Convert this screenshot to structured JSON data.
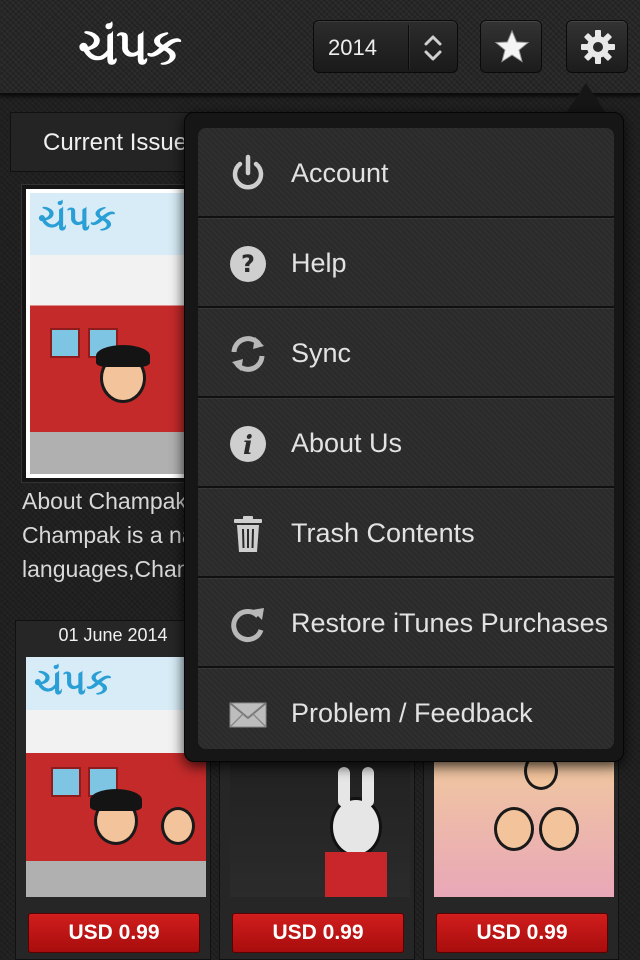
{
  "header": {
    "logo_text": "ચંપક",
    "year_value": "2014",
    "favorites_icon": "star-icon",
    "settings_icon": "gear-icon"
  },
  "current_issue": {
    "section_title": "Current Issue",
    "cover_title": "ચંપક",
    "about_lines": [
      "About Champak",
      "Champak is a na",
      "languages,Cham"
    ]
  },
  "issues": [
    {
      "date": "01 June 2014",
      "price": "USD 0.99"
    },
    {
      "date": "",
      "price": "USD 0.99"
    },
    {
      "date": "",
      "price": "USD 0.99"
    }
  ],
  "settings_menu": {
    "items": [
      {
        "label": "Account",
        "icon": "power-icon"
      },
      {
        "label": "Help",
        "icon": "question-icon"
      },
      {
        "label": "Sync",
        "icon": "sync-icon"
      },
      {
        "label": "About Us",
        "icon": "info-icon"
      },
      {
        "label": "Trash Contents",
        "icon": "trash-icon"
      },
      {
        "label": "Restore iTunes Purchases",
        "icon": "restore-icon"
      },
      {
        "label": "Problem / Feedback",
        "icon": "envelope-icon"
      }
    ]
  },
  "colors": {
    "background": "#1f1f1f",
    "price_button": "#c01515",
    "menu_text": "#e2e2e2",
    "cover_accent": "#2a9fd6"
  }
}
